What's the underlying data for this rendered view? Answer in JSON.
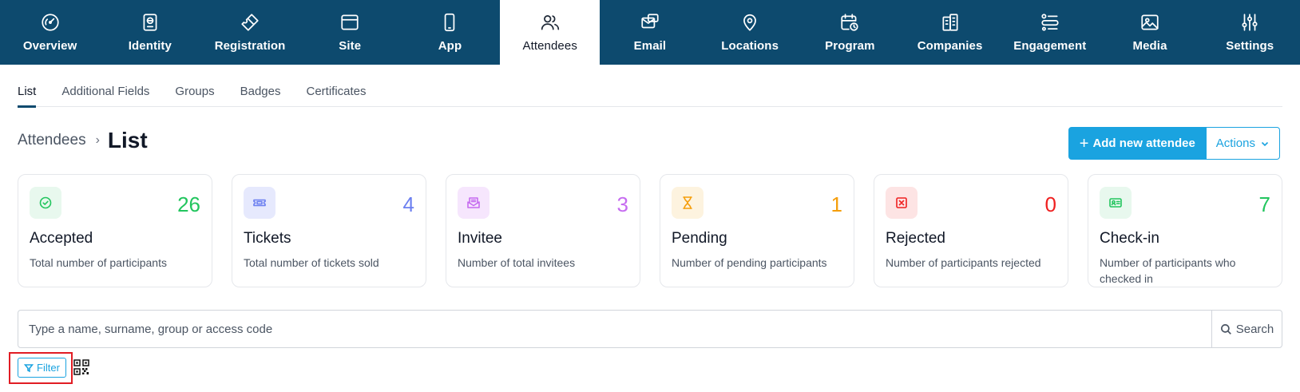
{
  "topnav": {
    "items": [
      {
        "label": "Overview",
        "icon": "gauge-icon"
      },
      {
        "label": "Identity",
        "icon": "passport-icon"
      },
      {
        "label": "Registration",
        "icon": "ticket-icon"
      },
      {
        "label": "Site",
        "icon": "browser-window-icon"
      },
      {
        "label": "App",
        "icon": "mobile-phone-icon"
      },
      {
        "label": "Attendees",
        "icon": "users-icon",
        "active": true
      },
      {
        "label": "Email",
        "icon": "email-icon"
      },
      {
        "label": "Locations",
        "icon": "map-pin-icon"
      },
      {
        "label": "Program",
        "icon": "calendar-clock-icon"
      },
      {
        "label": "Companies",
        "icon": "building-icon"
      },
      {
        "label": "Engagement",
        "icon": "engagement-list-icon"
      },
      {
        "label": "Media",
        "icon": "image-icon"
      },
      {
        "label": "Settings",
        "icon": "sliders-icon"
      }
    ]
  },
  "subtabs": [
    {
      "label": "List",
      "active": true
    },
    {
      "label": "Additional Fields"
    },
    {
      "label": "Groups"
    },
    {
      "label": "Badges"
    },
    {
      "label": "Certificates"
    }
  ],
  "breadcrumb": {
    "parent": "Attendees",
    "separator": "›",
    "current": "List"
  },
  "actions": {
    "add_label": "Add new attendee",
    "add_prefix": "+",
    "actions_label": "Actions"
  },
  "cards": [
    {
      "count": "26",
      "title": "Accepted",
      "description": "Total number of participants",
      "color": "#22c55e",
      "bg": "#e8f8ee",
      "icon": "check-circle-icon"
    },
    {
      "count": "4",
      "title": "Tickets",
      "description": "Total number of tickets sold",
      "color": "#6b7ff0",
      "bg": "#e6e9fd",
      "icon": "ticket-icon"
    },
    {
      "count": "3",
      "title": "Invitee",
      "description": "Number of total invitees",
      "color": "#c66cf0",
      "bg": "#f6e6fd",
      "icon": "mail-open-icon"
    },
    {
      "count": "1",
      "title": "Pending",
      "description": "Number of pending participants",
      "color": "#f59e0b",
      "bg": "#fdf3df",
      "icon": "hourglass-icon"
    },
    {
      "count": "0",
      "title": "Rejected",
      "description": "Number of participants rejected",
      "color": "#ef2020",
      "bg": "#fde4e4",
      "icon": "x-square-icon"
    },
    {
      "count": "7",
      "title": "Check-in",
      "description": "Number of participants who checked in",
      "color": "#22c55e",
      "bg": "#e8f8ee",
      "icon": "id-card-icon"
    }
  ],
  "search": {
    "placeholder": "Type a name, surname, group or access code",
    "value": "",
    "button_label": "Search"
  },
  "filter": {
    "label": "Filter"
  }
}
